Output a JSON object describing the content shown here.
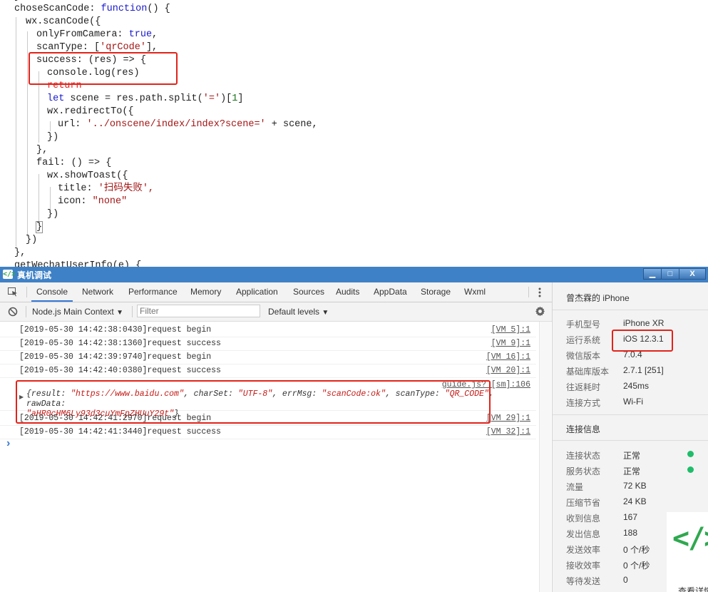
{
  "editor": {
    "top_partial": "}",
    "func_name": "choseScanCode",
    "func_kw": "function",
    "call": "wx.scanCode({",
    "only_from_camera_key": "onlyFromCamera:",
    "only_from_camera_val": "true",
    "scan_type_key": "scanType:",
    "scan_type_val": "'qrCode'",
    "success_line": "success: (res) => {",
    "console_line": "console.log(res)",
    "return_kw": "return",
    "let_kw": "let",
    "scene_expr": " scene = res.path.split(",
    "split_arg": "'='",
    "index_open": ")[",
    "index_num": "1",
    "index_close": "]",
    "redirect_line": "wx.redirectTo({",
    "url_key": "url:",
    "url_val": "'../onscene/index/index?scene='",
    "url_rest": " + scene,",
    "close_paren": "})",
    "close_brace_comma": "},",
    "fail_line": "fail: () => {",
    "toast_line": "wx.showToast({",
    "title_key": "title:",
    "title_val": "'扫码失败',",
    "icon_key": "icon:",
    "icon_val": "\"none\"",
    "close_brace": "}",
    "next_partial": "getWechatUserInfo(e) {"
  },
  "window": {
    "title": "真机调试",
    "logo": "</>",
    "minimize": "▁",
    "maximize": "□",
    "close": "X"
  },
  "tabs": [
    {
      "label": "Console"
    },
    {
      "label": "Network"
    },
    {
      "label": "Performance"
    },
    {
      "label": "Memory"
    },
    {
      "label": "Application"
    },
    {
      "label": "Sources"
    },
    {
      "label": "Audits"
    },
    {
      "label": "AppData"
    },
    {
      "label": "Storage"
    },
    {
      "label": "Wxml"
    }
  ],
  "toolbar": {
    "context": "Node.js Main Context",
    "filter_placeholder": "Filter",
    "levels": "Default levels"
  },
  "console": {
    "rows": [
      {
        "msg": "[2019-05-30 14:42:38:0430]request begin",
        "src": "[VM 5]:1"
      },
      {
        "msg": "[2019-05-30 14:42:38:1360]request success",
        "src": "[VM 9]:1"
      },
      {
        "msg": "[2019-05-30 14:42:39:9740]request begin",
        "src": "[VM 16]:1"
      },
      {
        "msg": "[2019-05-30 14:42:40:0380]request success",
        "src": "[VM 20]:1"
      }
    ],
    "obj_src": "guide.js? [sm]:106",
    "obj": {
      "open": "{",
      "k1": "result:",
      "v1": "\"https://www.baidu.com\"",
      "k2": "charSet:",
      "v2": "\"UTF-8\"",
      "k3": "errMsg:",
      "v3": "\"scanCode:ok\"",
      "k4": "scanType:",
      "v4": "\"QR_CODE\"",
      "k5": "rawData:",
      "v5": "\"aHR0cHM6Ly93d3cuYmFpZHUuY29t\"",
      "close": "}"
    },
    "rows2": [
      {
        "msg": "[2019-05-30 14:42:41:2970]request begin",
        "src": "[VM 29]:1"
      },
      {
        "msg": "[2019-05-30 14:42:41:3440]request success",
        "src": "[VM 32]:1"
      }
    ],
    "prompt": "›"
  },
  "side": {
    "device_title": "曾杰霖的 iPhone",
    "info": [
      {
        "label": "手机型号",
        "value": "iPhone XR"
      },
      {
        "label": "运行系统",
        "value": "iOS 12.3.1"
      },
      {
        "label": "微信版本",
        "value": "7.0.4"
      },
      {
        "label": "基础库版本",
        "value": "2.7.1 [251]"
      },
      {
        "label": "往返耗时",
        "value": "245ms"
      },
      {
        "label": "连接方式",
        "value": "Wi-Fi"
      }
    ],
    "conn_title": "连接信息",
    "conn": [
      {
        "label": "连接状态",
        "value": "正常"
      },
      {
        "label": "服务状态",
        "value": "正常"
      },
      {
        "label": "流量",
        "value": "72 KB"
      },
      {
        "label": "压缩节省",
        "value": "24 KB"
      },
      {
        "label": "收到信息",
        "value": "167"
      },
      {
        "label": "发出信息",
        "value": "188"
      },
      {
        "label": "发送效率",
        "value": "0 个/秒"
      },
      {
        "label": "接收效率",
        "value": "0 个/秒"
      },
      {
        "label": "等待发送",
        "value": "0"
      }
    ],
    "overlay_logo": "</>",
    "overlay_text": "查看详情"
  },
  "colors": {
    "titlebar": "#3f81c6",
    "highlight": "#e2231a",
    "status_ok": "#1fbd6a",
    "logo_green": "#2fa84f"
  }
}
